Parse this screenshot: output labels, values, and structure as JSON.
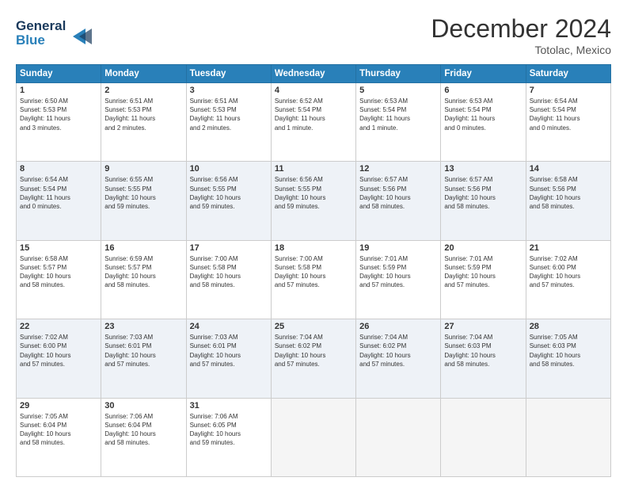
{
  "header": {
    "logo_line1": "General",
    "logo_line2": "Blue",
    "month": "December 2024",
    "location": "Totolac, Mexico"
  },
  "weekdays": [
    "Sunday",
    "Monday",
    "Tuesday",
    "Wednesday",
    "Thursday",
    "Friday",
    "Saturday"
  ],
  "weeks": [
    [
      {
        "day": "1",
        "detail": "Sunrise: 6:50 AM\nSunset: 5:53 PM\nDaylight: 11 hours\nand 3 minutes."
      },
      {
        "day": "2",
        "detail": "Sunrise: 6:51 AM\nSunset: 5:53 PM\nDaylight: 11 hours\nand 2 minutes."
      },
      {
        "day": "3",
        "detail": "Sunrise: 6:51 AM\nSunset: 5:53 PM\nDaylight: 11 hours\nand 2 minutes."
      },
      {
        "day": "4",
        "detail": "Sunrise: 6:52 AM\nSunset: 5:54 PM\nDaylight: 11 hours\nand 1 minute."
      },
      {
        "day": "5",
        "detail": "Sunrise: 6:53 AM\nSunset: 5:54 PM\nDaylight: 11 hours\nand 1 minute."
      },
      {
        "day": "6",
        "detail": "Sunrise: 6:53 AM\nSunset: 5:54 PM\nDaylight: 11 hours\nand 0 minutes."
      },
      {
        "day": "7",
        "detail": "Sunrise: 6:54 AM\nSunset: 5:54 PM\nDaylight: 11 hours\nand 0 minutes."
      }
    ],
    [
      {
        "day": "8",
        "detail": "Sunrise: 6:54 AM\nSunset: 5:54 PM\nDaylight: 11 hours\nand 0 minutes."
      },
      {
        "day": "9",
        "detail": "Sunrise: 6:55 AM\nSunset: 5:55 PM\nDaylight: 10 hours\nand 59 minutes."
      },
      {
        "day": "10",
        "detail": "Sunrise: 6:56 AM\nSunset: 5:55 PM\nDaylight: 10 hours\nand 59 minutes."
      },
      {
        "day": "11",
        "detail": "Sunrise: 6:56 AM\nSunset: 5:55 PM\nDaylight: 10 hours\nand 59 minutes."
      },
      {
        "day": "12",
        "detail": "Sunrise: 6:57 AM\nSunset: 5:56 PM\nDaylight: 10 hours\nand 58 minutes."
      },
      {
        "day": "13",
        "detail": "Sunrise: 6:57 AM\nSunset: 5:56 PM\nDaylight: 10 hours\nand 58 minutes."
      },
      {
        "day": "14",
        "detail": "Sunrise: 6:58 AM\nSunset: 5:56 PM\nDaylight: 10 hours\nand 58 minutes."
      }
    ],
    [
      {
        "day": "15",
        "detail": "Sunrise: 6:58 AM\nSunset: 5:57 PM\nDaylight: 10 hours\nand 58 minutes."
      },
      {
        "day": "16",
        "detail": "Sunrise: 6:59 AM\nSunset: 5:57 PM\nDaylight: 10 hours\nand 58 minutes."
      },
      {
        "day": "17",
        "detail": "Sunrise: 7:00 AM\nSunset: 5:58 PM\nDaylight: 10 hours\nand 58 minutes."
      },
      {
        "day": "18",
        "detail": "Sunrise: 7:00 AM\nSunset: 5:58 PM\nDaylight: 10 hours\nand 57 minutes."
      },
      {
        "day": "19",
        "detail": "Sunrise: 7:01 AM\nSunset: 5:59 PM\nDaylight: 10 hours\nand 57 minutes."
      },
      {
        "day": "20",
        "detail": "Sunrise: 7:01 AM\nSunset: 5:59 PM\nDaylight: 10 hours\nand 57 minutes."
      },
      {
        "day": "21",
        "detail": "Sunrise: 7:02 AM\nSunset: 6:00 PM\nDaylight: 10 hours\nand 57 minutes."
      }
    ],
    [
      {
        "day": "22",
        "detail": "Sunrise: 7:02 AM\nSunset: 6:00 PM\nDaylight: 10 hours\nand 57 minutes."
      },
      {
        "day": "23",
        "detail": "Sunrise: 7:03 AM\nSunset: 6:01 PM\nDaylight: 10 hours\nand 57 minutes."
      },
      {
        "day": "24",
        "detail": "Sunrise: 7:03 AM\nSunset: 6:01 PM\nDaylight: 10 hours\nand 57 minutes."
      },
      {
        "day": "25",
        "detail": "Sunrise: 7:04 AM\nSunset: 6:02 PM\nDaylight: 10 hours\nand 57 minutes."
      },
      {
        "day": "26",
        "detail": "Sunrise: 7:04 AM\nSunset: 6:02 PM\nDaylight: 10 hours\nand 57 minutes."
      },
      {
        "day": "27",
        "detail": "Sunrise: 7:04 AM\nSunset: 6:03 PM\nDaylight: 10 hours\nand 58 minutes."
      },
      {
        "day": "28",
        "detail": "Sunrise: 7:05 AM\nSunset: 6:03 PM\nDaylight: 10 hours\nand 58 minutes."
      }
    ],
    [
      {
        "day": "29",
        "detail": "Sunrise: 7:05 AM\nSunset: 6:04 PM\nDaylight: 10 hours\nand 58 minutes."
      },
      {
        "day": "30",
        "detail": "Sunrise: 7:06 AM\nSunset: 6:04 PM\nDaylight: 10 hours\nand 58 minutes."
      },
      {
        "day": "31",
        "detail": "Sunrise: 7:06 AM\nSunset: 6:05 PM\nDaylight: 10 hours\nand 59 minutes."
      },
      {
        "day": "",
        "detail": ""
      },
      {
        "day": "",
        "detail": ""
      },
      {
        "day": "",
        "detail": ""
      },
      {
        "day": "",
        "detail": ""
      }
    ]
  ]
}
